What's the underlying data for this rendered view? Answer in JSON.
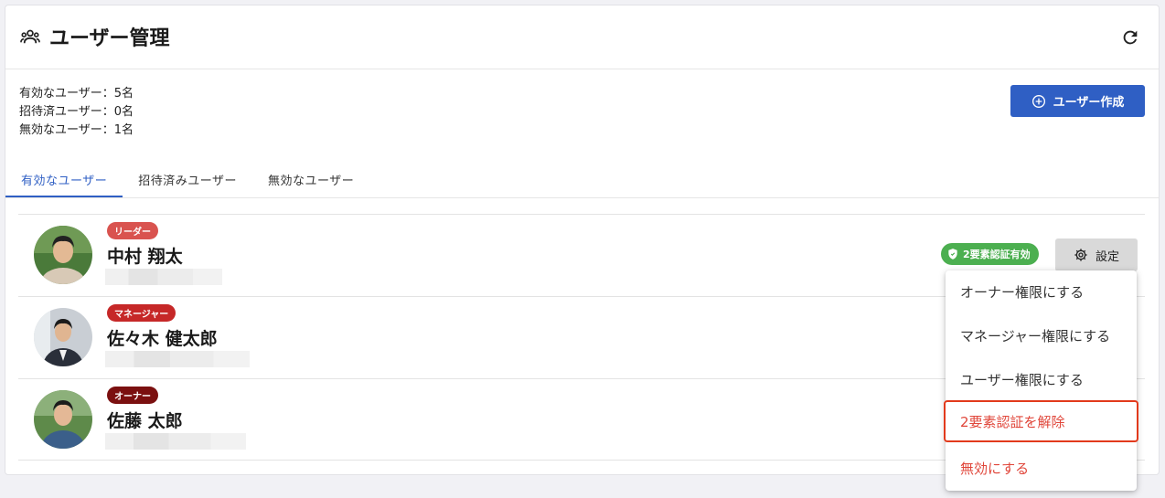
{
  "header": {
    "title": "ユーザー管理",
    "title_icon": "users-icon",
    "refresh_icon": "refresh-icon"
  },
  "stats": {
    "active": "有効なユーザー：5名",
    "invited": "招待済ユーザー：0名",
    "disabled": "無効なユーザー：1名"
  },
  "create_button": {
    "label": "ユーザー作成",
    "icon": "plus-circle-icon"
  },
  "tabs": [
    {
      "label": "有効なユーザー",
      "active": true
    },
    {
      "label": "招待済みユーザー",
      "active": false
    },
    {
      "label": "無効なユーザー",
      "active": false
    }
  ],
  "users": [
    {
      "role": "リーダー",
      "role_color": "#d9534f",
      "name": "中村 翔太",
      "twofa": "2要素認証有効",
      "settings": "設定"
    },
    {
      "role": "マネージャー",
      "role_color": "#c62828",
      "name": "佐々木 健太郎"
    },
    {
      "role": "オーナー",
      "role_color": "#7b1010",
      "name": "佐藤 太郎"
    }
  ],
  "menu": {
    "items": [
      {
        "label": "オーナー権限にする",
        "danger": false
      },
      {
        "label": "マネージャー権限にする",
        "danger": false
      },
      {
        "label": "ユーザー権限にする",
        "danger": false
      },
      {
        "label": "2要素認証を解除",
        "danger": true,
        "highlighted": true
      },
      {
        "label": "無効にする",
        "danger": true
      }
    ]
  },
  "colors": {
    "primary": "#2f5fc4",
    "success": "#4caf50",
    "danger": "#e0463a"
  }
}
